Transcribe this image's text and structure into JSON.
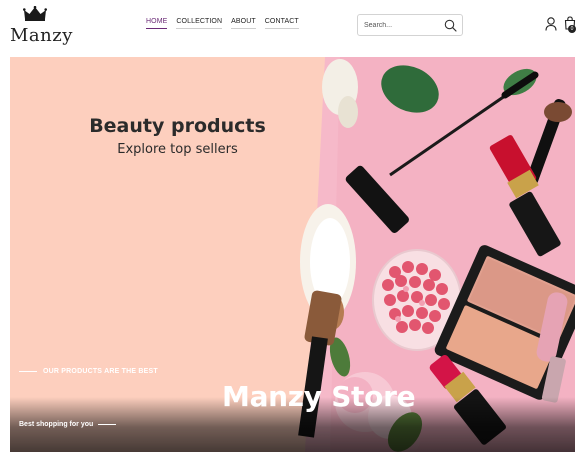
{
  "brand": {
    "name": "Manzy",
    "crown_color": "#1a1a1a"
  },
  "nav": {
    "items": [
      {
        "label": "HOME",
        "active": true
      },
      {
        "label": "COLLECTION",
        "active": false
      },
      {
        "label": "ABOUT",
        "active": false
      },
      {
        "label": "CONTACT",
        "active": false
      }
    ],
    "active_color": "#6a2a76"
  },
  "search": {
    "placeholder": "Search...",
    "value": "",
    "icon": "search-icon"
  },
  "account": {
    "icon": "user-icon"
  },
  "cart": {
    "icon": "shopping-bag-icon",
    "count": "0"
  },
  "hero": {
    "title": "Beauty products",
    "subtitle": "Explore top sellers",
    "tagline": "OUR PRODUCTS ARE THE BEST",
    "store_name": "Manzy Store",
    "shopping_text": "Best shopping for you",
    "colors": {
      "panel": "#fdcfbe",
      "photo_background": "#f6b9c9",
      "lipstick": "#c8102e",
      "gold": "#c9a24a"
    }
  }
}
